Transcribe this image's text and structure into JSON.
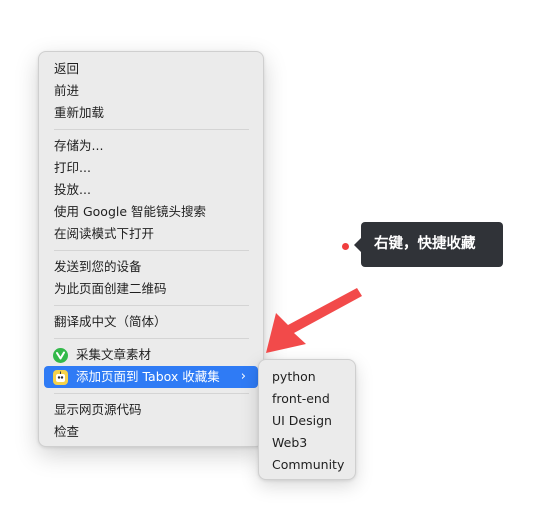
{
  "context_menu": {
    "groups": [
      [
        "返回",
        "前进",
        "重新加载"
      ],
      [
        "存储为...",
        "打印...",
        "投放...",
        "使用 Google 智能镜头搜索",
        "在阅读模式下打开"
      ],
      [
        "发送到您的设备",
        "为此页面创建二维码"
      ],
      [
        "翻译成中文（简体）"
      ],
      [
        "采集文章素材",
        "添加页面到 Tabox 收藏集"
      ],
      [
        "显示网页源代码",
        "检查"
      ]
    ],
    "highlight_color": "#2f7bf5",
    "submenu_arrow": "chevron-right-icon"
  },
  "submenu": {
    "items": [
      "python",
      "front-end",
      "UI Design",
      "Web3",
      "Community"
    ]
  },
  "annotation": {
    "tooltip_text": "右键，快捷收藏",
    "arrow_color": "#f24a4a",
    "dot_color": "#f03e3e"
  }
}
